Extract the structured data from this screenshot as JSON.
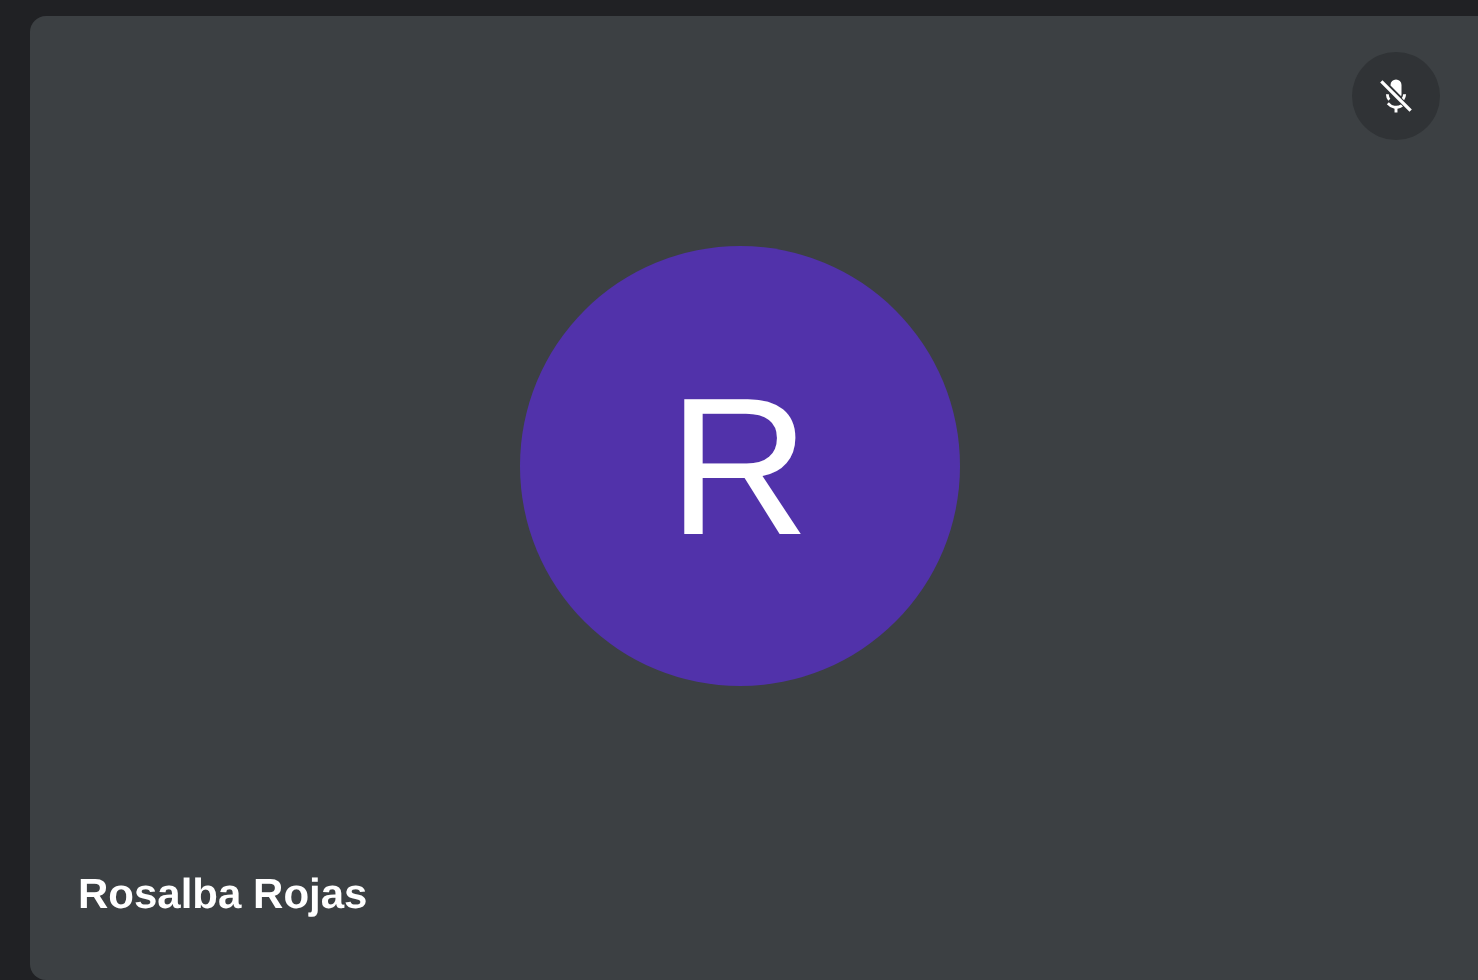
{
  "participant": {
    "name": "Rosalba Rojas",
    "initial": "R",
    "color": "#5132aa",
    "muted": true
  }
}
